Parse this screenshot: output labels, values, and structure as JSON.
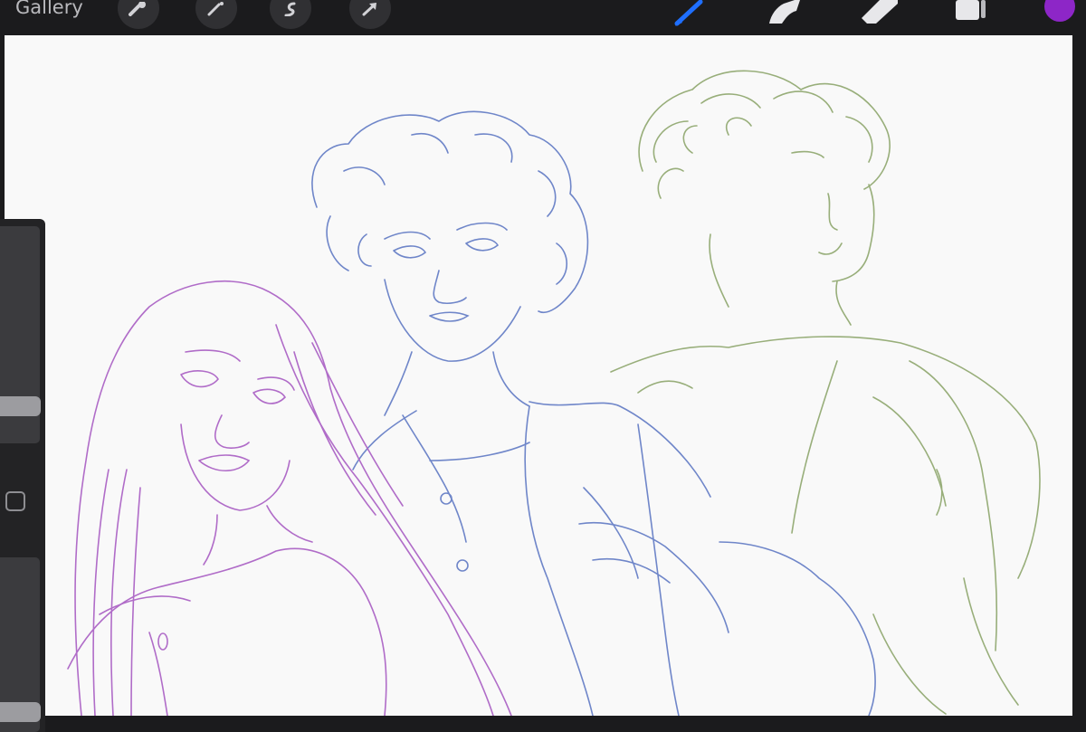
{
  "toolbar": {
    "gallery_label": "Gallery",
    "left_tools": [
      "wrench-icon",
      "magic-wand-icon",
      "selection-s-icon",
      "transform-arrow-icon"
    ],
    "right_tools": [
      "brush-icon",
      "smudge-icon",
      "eraser-icon",
      "layers-icon"
    ],
    "active_tool": "brush-icon",
    "active_color": "#8d26c7",
    "accent_color": "#1f6fff"
  },
  "sidebar": {
    "controls": [
      "brush-size-slider",
      "modify-button-icon",
      "brush-opacity-slider"
    ]
  },
  "canvas": {
    "background": "#f9f9f9",
    "sketch_colors": [
      "#b06cc8",
      "#6f86c9",
      "#98ae7a"
    ]
  }
}
